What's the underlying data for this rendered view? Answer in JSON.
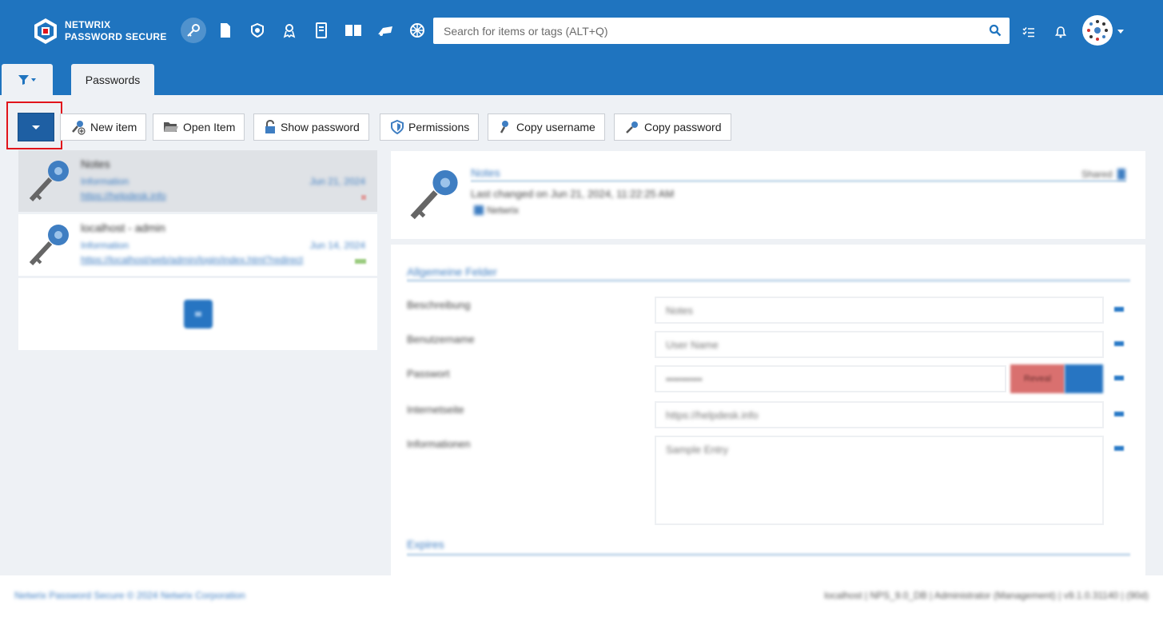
{
  "header": {
    "brand_line1": "NETWRIX",
    "brand_line2": "PASSWORD SECURE",
    "search_placeholder": "Search for items or tags (ALT+Q)",
    "accent_color": "#1f74bf"
  },
  "tabs": {
    "main_tab_label": "Passwords"
  },
  "toolbar": {
    "new_item": "New item",
    "open_item": "Open Item",
    "show_password": "Show password",
    "permissions": "Permissions",
    "copy_username": "Copy username",
    "copy_password": "Copy password"
  },
  "list": {
    "items": [
      {
        "title": "Notes",
        "sub": "Information",
        "url": "https://helpdesk.info",
        "date": "Jun 21, 2024",
        "mark_color": "#e0a0a0"
      },
      {
        "title": "localhost - admin",
        "sub": "Information",
        "url": "https://localhost/web/admin/login/index.html?redirect",
        "date": "Jun 14, 2024",
        "mark_color": "#9ccc80"
      }
    ]
  },
  "detail": {
    "title": "Notes",
    "last_changed": "Last changed on Jun 21, 2024, 11:22:25 AM",
    "tag": "Netwrix",
    "shared": "Shared",
    "section_general": "Allgemeine Felder",
    "section_expiry": "Expires",
    "fields": [
      {
        "label": "Beschreibung",
        "value": "Notes"
      },
      {
        "label": "Benutzername",
        "value": "User Name"
      },
      {
        "label": "Passwort",
        "value": "••••••••••"
      },
      {
        "label": "Internetseite",
        "value": "https://helpdesk.info"
      },
      {
        "label": "Informationen",
        "value": "Sample Entry"
      }
    ],
    "reveal_label": "Reveal"
  },
  "footer": {
    "left": "Netwrix Password Secure © 2024 Netwrix Corporation",
    "right": "localhost | NPS_9.0_DB | Administrator (Management) | v9.1.0.31140 | (90d)"
  }
}
